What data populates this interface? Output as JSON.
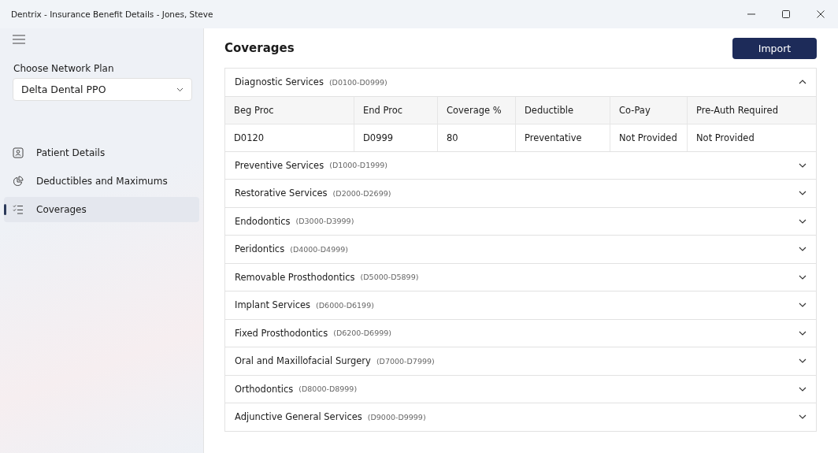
{
  "window": {
    "title": "Dentrix - Insurance Benefit Details - Jones, Steve"
  },
  "sidebar": {
    "plan_label": "Choose Network Plan",
    "plan_value": "Delta Dental PPO",
    "items": [
      {
        "label": "Patient Details",
        "kind": "patient",
        "selected": false
      },
      {
        "label": "Deductibles and Maximums",
        "kind": "pie",
        "selected": false
      },
      {
        "label": "Coverages",
        "kind": "list",
        "selected": true
      }
    ]
  },
  "main": {
    "title": "Coverages",
    "import_button": "Import",
    "sections": [
      {
        "name": "Diagnostic Services",
        "range": "(D0100-D0999)",
        "expanded": true,
        "table": {
          "columns": [
            "Beg Proc",
            "End Proc",
            "Coverage %",
            "Deductible",
            "Co-Pay",
            "Pre-Auth Required"
          ],
          "rows": [
            [
              "D0120",
              "D0999",
              "80",
              "Preventative",
              "Not Provided",
              "Not Provided"
            ]
          ]
        }
      },
      {
        "name": "Preventive Services",
        "range": "(D1000-D1999)",
        "expanded": false
      },
      {
        "name": "Restorative Services",
        "range": "(D2000-D2699)",
        "expanded": false
      },
      {
        "name": "Endodontics",
        "range": "(D3000-D3999)",
        "expanded": false
      },
      {
        "name": "Peridontics",
        "range": "(D4000-D4999)",
        "expanded": false
      },
      {
        "name": "Removable Prosthodontics",
        "range": "(D5000-D5899)",
        "expanded": false
      },
      {
        "name": "Implant Services",
        "range": "(D6000-D6199)",
        "expanded": false
      },
      {
        "name": "Fixed Prosthodontics",
        "range": "(D6200-D6999)",
        "expanded": false
      },
      {
        "name": "Oral and Maxillofacial Surgery",
        "range": "(D7000-D7999)",
        "expanded": false
      },
      {
        "name": "Orthodontics",
        "range": "(D8000-D8999)",
        "expanded": false
      },
      {
        "name": "Adjunctive General Services",
        "range": "(D9000-D9999)",
        "expanded": false
      }
    ]
  }
}
